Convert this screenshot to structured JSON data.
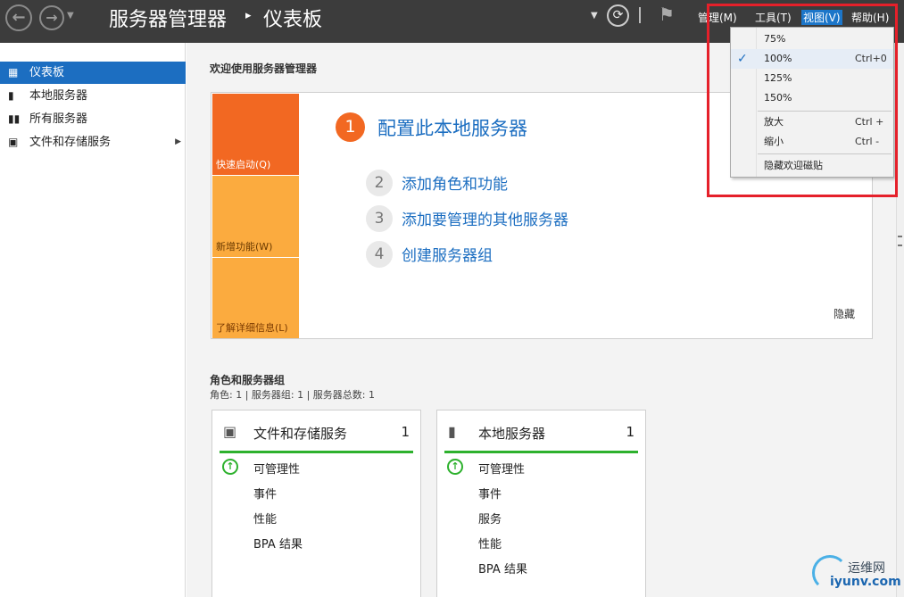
{
  "titlebar": {
    "app_title": "服务器管理器",
    "separator": "▸",
    "page_title": "仪表板",
    "menus": {
      "manage": "管理(M)",
      "tools": "工具(T)",
      "view": "视图(V)",
      "help": "帮助(H)"
    }
  },
  "sidebar": {
    "items": [
      {
        "label": "仪表板",
        "icon": "dashboard-icon"
      },
      {
        "label": "本地服务器",
        "icon": "server-icon"
      },
      {
        "label": "所有服务器",
        "icon": "servers-icon"
      },
      {
        "label": "文件和存储服务",
        "icon": "folder-icon"
      }
    ]
  },
  "welcome": {
    "title": "欢迎使用服务器管理器",
    "tiles": {
      "quick_start": "快速启动(Q)",
      "whats_new": "新增功能(W)",
      "learn_more": "了解详细信息(L)"
    },
    "steps": [
      {
        "num": "1",
        "label": "配置此本地服务器"
      },
      {
        "num": "2",
        "label": "添加角色和功能"
      },
      {
        "num": "3",
        "label": "添加要管理的其他服务器"
      },
      {
        "num": "4",
        "label": "创建服务器组"
      }
    ],
    "hide": "隐藏"
  },
  "roles": {
    "title": "角色和服务器组",
    "subtitle": "角色: 1 | 服务器组: 1 | 服务器总数: 1",
    "cards": [
      {
        "title": "文件和存储服务",
        "count": "1",
        "rows": [
          "可管理性",
          "事件",
          "性能",
          "BPA 结果"
        ]
      },
      {
        "title": "本地服务器",
        "count": "1",
        "rows": [
          "可管理性",
          "事件",
          "服务",
          "性能",
          "BPA 结果"
        ]
      }
    ]
  },
  "view_menu": {
    "zoom": [
      {
        "label": "75%",
        "shortcut": "",
        "checked": false
      },
      {
        "label": "100%",
        "shortcut": "Ctrl+0",
        "checked": true
      },
      {
        "label": "125%",
        "shortcut": "",
        "checked": false
      },
      {
        "label": "150%",
        "shortcut": "",
        "checked": false
      }
    ],
    "zoom_in": {
      "label": "放大",
      "shortcut": "Ctrl +"
    },
    "zoom_out": {
      "label": "缩小",
      "shortcut": "Ctrl -"
    },
    "hide_welcome": "隐藏欢迎磁贴",
    "check": "✓"
  },
  "watermark": {
    "cn": "运维网",
    "url": "iyunv.com"
  },
  "colors": {
    "accent": "#1c6ec1",
    "orange": "#f26822",
    "amber": "#fbab3f",
    "status_green": "#2db12d",
    "highlight_red": "#e5202a"
  }
}
